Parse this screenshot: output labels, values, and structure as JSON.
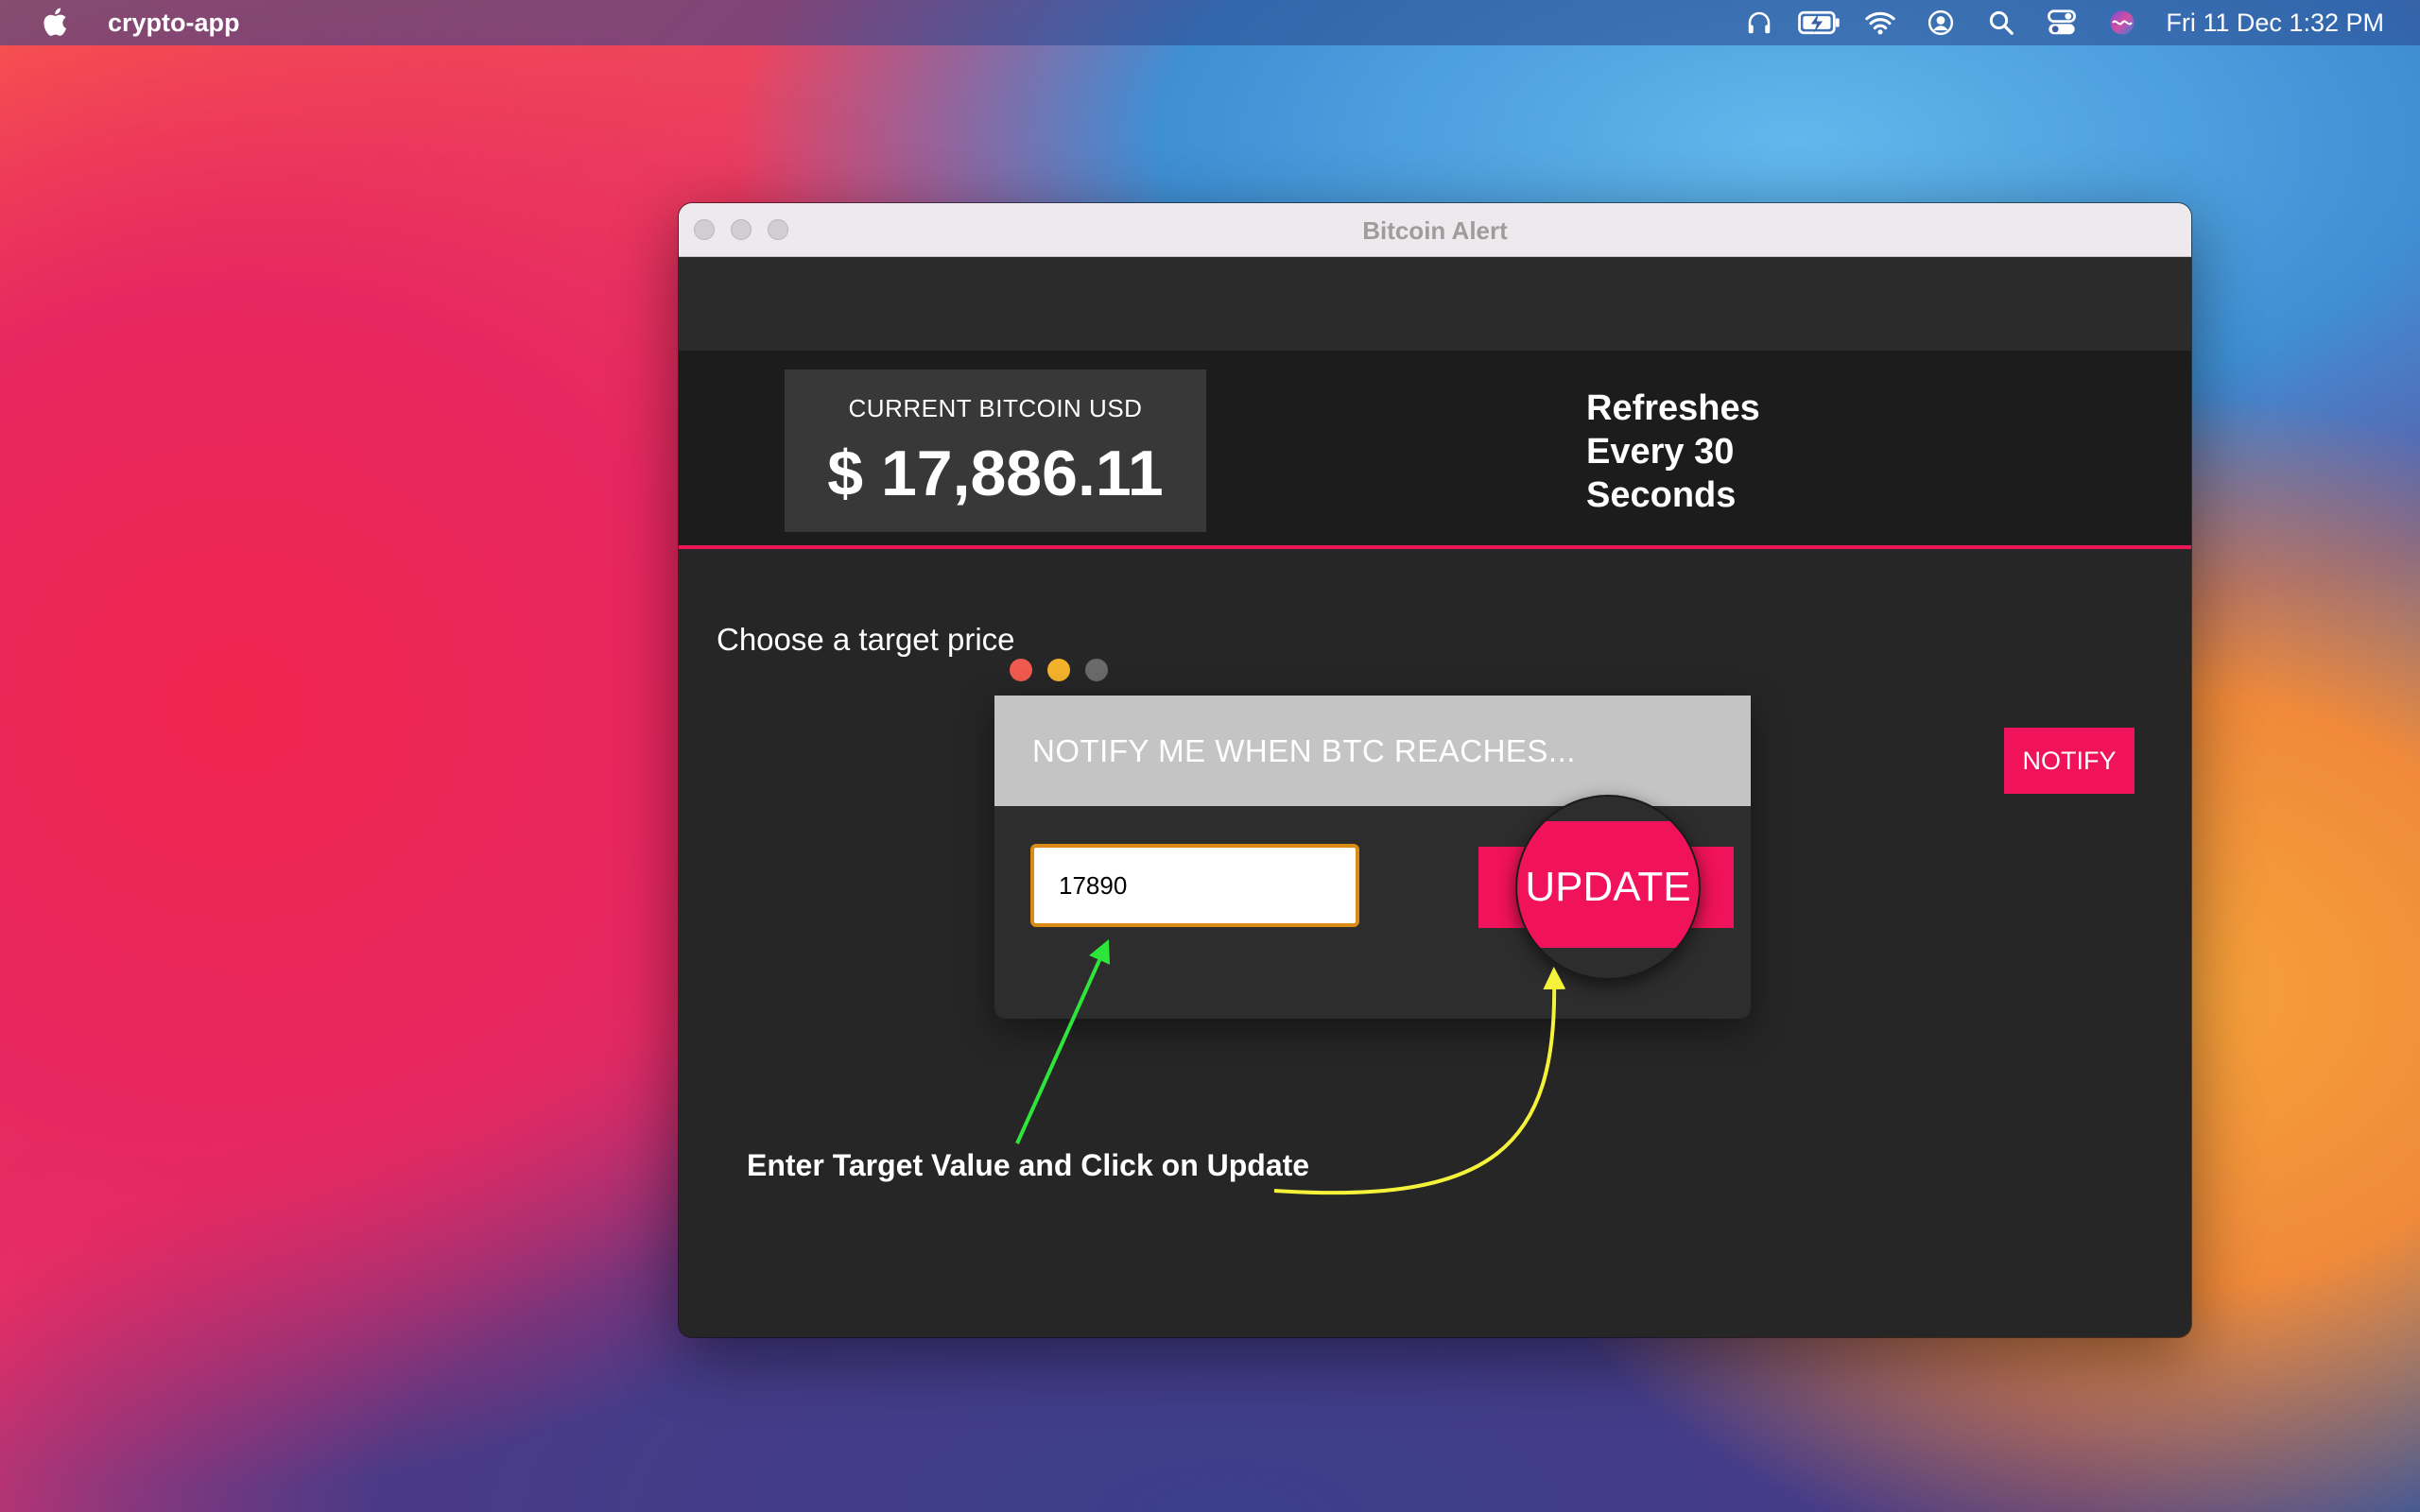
{
  "menubar": {
    "app_name": "crypto-app",
    "datetime": "Fri 11 Dec  1:32 PM",
    "icons": [
      "apple-icon",
      "headphones-icon",
      "battery-charging-icon",
      "wifi-icon",
      "user-icon",
      "search-icon",
      "control-center-icon",
      "siri-icon"
    ]
  },
  "window": {
    "title": "Bitcoin Alert",
    "price_label": "CURRENT BITCOIN USD",
    "price_value": "$ 17,886.11",
    "refresh_text": "Refreshes Every 30 Seconds",
    "choose_label": "Choose a target price",
    "notify_button": "NOTIFY"
  },
  "dialog": {
    "header": "NOTIFY ME WHEN BTC REACHES...",
    "target_value": "17890",
    "update_button": "UPDATE",
    "dot_colors": [
      "#f05a4f",
      "#f4b22b",
      "#6a6a6a"
    ]
  },
  "annotation": {
    "text": "Enter Target Value and Click on Update",
    "colors": {
      "green_arrow": "#2ee63a",
      "yellow_arrow": "#f5f23a"
    }
  },
  "colors": {
    "accent": "#f0125a",
    "input_border": "#d98b14",
    "window_bg": "#262626"
  }
}
